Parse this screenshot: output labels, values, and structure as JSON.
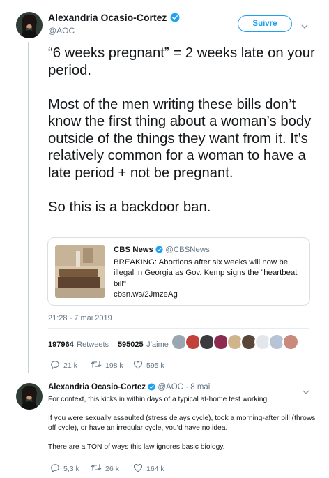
{
  "tweet": {
    "author_name": "Alexandria Ocasio-Cortez",
    "author_handle": "@AOC",
    "follow_label": "Suivre",
    "paragraphs": [
      "“6 weeks pregnant” = 2 weeks late on your period.",
      "Most of the men writing these bills don’t know the first thing about a woman’s body outside of the things they want from it. It’s relatively common for a woman to have a late period + not be pregnant.",
      "So this is a backdoor ban."
    ],
    "timestamp": "21:28 - 7 mai 2019",
    "retweets_count": "197964",
    "retweets_label": "Retweets",
    "likes_count": "595025",
    "likes_label": "J’aime",
    "actions": {
      "replies": "21 k",
      "retweets": "198 k",
      "likes": "595 k"
    }
  },
  "quoted": {
    "name": "CBS News",
    "handle": "@CBSNews",
    "text": "BREAKING: Abortions after six weeks will now be illegal in Georgia as Gov. Kemp signs the \"heartbeat bill\"",
    "link": "cbsn.ws/2JmzeAg"
  },
  "reply": {
    "author_name": "Alexandria Ocasio-Cortez",
    "author_handle": "@AOC",
    "time": "8 mai",
    "paragraphs": [
      "For context, this kicks in within days of a typical at-home test working.",
      "If you were sexually assaulted (stress delays cycle), took a morning-after pill (throws off cycle), or have an irregular cycle, you’d have no idea.",
      "There are a TON of ways this law ignores basic biology."
    ],
    "actions": {
      "replies": "5,3 k",
      "retweets": "26 k",
      "likes": "164 k"
    }
  },
  "colors": {
    "accent": "#1da1f2",
    "muted": "#657786",
    "like_red": "#e0245e"
  },
  "icons": [
    "verified-badge-icon",
    "chevron-down-icon",
    "reply-icon",
    "retweet-icon",
    "heart-icon"
  ]
}
